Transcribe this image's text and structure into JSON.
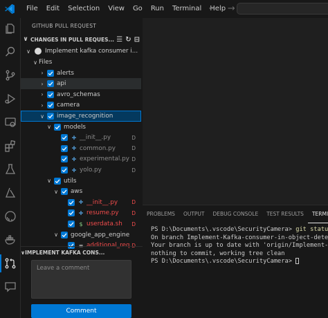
{
  "menu": [
    "File",
    "Edit",
    "Selection",
    "View",
    "Go",
    "Run",
    "Terminal",
    "Help"
  ],
  "nav": {
    "back": "←",
    "forward": "→"
  },
  "sidebar": {
    "title": "GITHUB PULL REQUEST",
    "changes_header": "CHANGES IN PULL REQUES...",
    "pr_title": "Implement kafka consumer i...",
    "tree": [
      {
        "label": "Files",
        "depth": 1,
        "chevron": "∨",
        "checkbox": false,
        "icon": "",
        "status": "",
        "style": "normal",
        "state": ""
      },
      {
        "label": "alerts",
        "depth": 2,
        "chevron": "›",
        "checkbox": true,
        "icon": "",
        "status": "",
        "style": "normal",
        "state": ""
      },
      {
        "label": "api",
        "depth": 2,
        "chevron": "›",
        "checkbox": true,
        "icon": "",
        "status": "",
        "style": "normal",
        "state": "hover"
      },
      {
        "label": "avro_schemas",
        "depth": 2,
        "chevron": "›",
        "checkbox": true,
        "icon": "",
        "status": "",
        "style": "normal",
        "state": ""
      },
      {
        "label": "camera",
        "depth": 2,
        "chevron": "›",
        "checkbox": true,
        "icon": "",
        "status": "",
        "style": "normal",
        "state": ""
      },
      {
        "label": "image_recognition",
        "depth": 2,
        "chevron": "∨",
        "checkbox": true,
        "icon": "",
        "status": "",
        "style": "normal",
        "state": "selected"
      },
      {
        "label": "models",
        "depth": 3,
        "chevron": "∨",
        "checkbox": true,
        "icon": "",
        "status": "",
        "style": "normal",
        "state": ""
      },
      {
        "label": "__init__.py",
        "depth": 4,
        "chevron": "",
        "checkbox": true,
        "icon": "python",
        "status": "D",
        "style": "dim",
        "state": ""
      },
      {
        "label": "common.py",
        "depth": 4,
        "chevron": "",
        "checkbox": true,
        "icon": "python",
        "status": "D",
        "style": "dim",
        "state": ""
      },
      {
        "label": "experimental.py",
        "depth": 4,
        "chevron": "",
        "checkbox": true,
        "icon": "python",
        "status": "D",
        "style": "dim",
        "state": ""
      },
      {
        "label": "yolo.py",
        "depth": 4,
        "chevron": "",
        "checkbox": true,
        "icon": "python",
        "status": "D",
        "style": "dim",
        "state": ""
      },
      {
        "label": "utils",
        "depth": 3,
        "chevron": "∨",
        "checkbox": true,
        "icon": "",
        "status": "",
        "style": "normal",
        "state": ""
      },
      {
        "label": "aws",
        "depth": 4,
        "chevron": "∨",
        "checkbox": true,
        "icon": "",
        "status": "",
        "style": "normal",
        "state": ""
      },
      {
        "label": "__init__.py",
        "depth": 5,
        "chevron": "",
        "checkbox": true,
        "icon": "python",
        "status": "D",
        "style": "deleted",
        "state": ""
      },
      {
        "label": "resume.py",
        "depth": 5,
        "chevron": "",
        "checkbox": true,
        "icon": "python",
        "status": "D",
        "style": "deleted",
        "state": ""
      },
      {
        "label": "userdata.sh",
        "depth": 5,
        "chevron": "",
        "checkbox": true,
        "icon": "shell",
        "status": "D",
        "style": "deleted",
        "state": ""
      },
      {
        "label": "google_app_engine",
        "depth": 4,
        "chevron": "∨",
        "checkbox": true,
        "icon": "",
        "status": "",
        "style": "normal",
        "state": ""
      },
      {
        "label": "additional_req...",
        "depth": 5,
        "chevron": "",
        "checkbox": true,
        "icon": "text",
        "status": "D",
        "style": "deleted",
        "state": ""
      }
    ],
    "second_panel_header": "IMPLEMENT KAFKA CONS...",
    "comment_placeholder": "Leave a comment",
    "comment_button": "Comment"
  },
  "panel": {
    "tabs": [
      "PROBLEMS",
      "OUTPUT",
      "DEBUG CONSOLE",
      "TEST RESULTS",
      "TERMINAL"
    ],
    "active_tab": "TERMINAL",
    "terminal": {
      "prompt1": "PS D:\\Documents\\.vscode\\SecurityCamera> ",
      "command1": "git status",
      "line2": "On branch Implement-Kafka-consumer-in-object-detection",
      "line3": "Your branch is up to date with 'origin/Implement-Kafka-consumer'.",
      "line4": "",
      "line5": "nothing to commit, working tree clean",
      "prompt2": "PS D:\\Documents\\.vscode\\SecurityCamera> "
    }
  },
  "colors": {
    "accent": "#0078d4",
    "deleted": "#f14c4c",
    "python_icon": "#4b8bbe",
    "shell_icon": "#89d185"
  }
}
